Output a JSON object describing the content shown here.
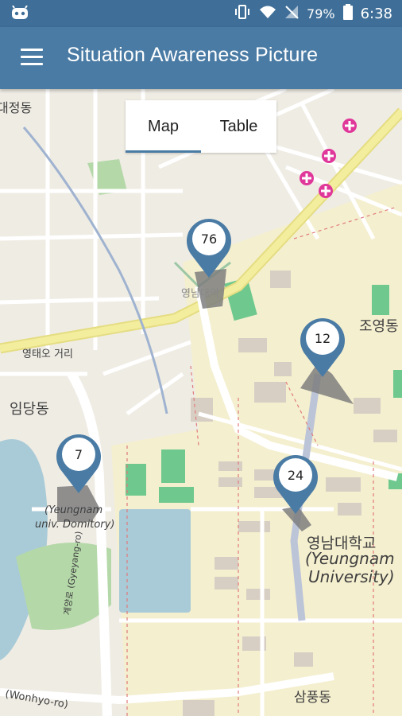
{
  "status": {
    "battery": "79%",
    "time": "6:38"
  },
  "app": {
    "title": "Situation Awareness Picture"
  },
  "tabs": [
    {
      "label": "Map"
    },
    {
      "label": "Table"
    }
  ],
  "map_labels": [
    {
      "text": "영남대학교"
    },
    {
      "text": "(Yeungnam"
    },
    {
      "text": "University)"
    },
    {
      "text": "조영동"
    },
    {
      "text": "임당동"
    },
    {
      "text": "삼풍동"
    },
    {
      "text": "영태오 거리"
    },
    {
      "text": "(Yeungnam"
    },
    {
      "text": "univ. Domitory)"
    },
    {
      "text": "(Wonhyo-ro)"
    },
    {
      "text": "계양로 (Gyeyang-ro)"
    },
    {
      "text": "대정동"
    },
    {
      "text": "영남대역"
    }
  ],
  "markers": [
    {
      "count": "76"
    },
    {
      "count": "12"
    },
    {
      "count": "7"
    },
    {
      "count": "24"
    }
  ]
}
